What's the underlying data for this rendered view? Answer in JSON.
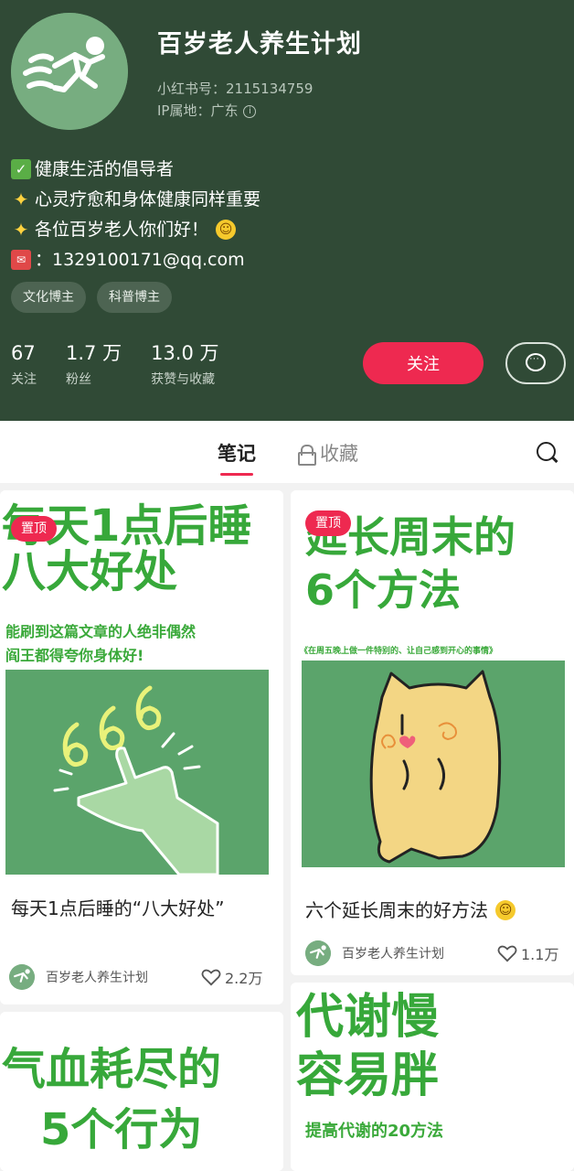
{
  "profile": {
    "name": "百岁老人养生计划",
    "account_id": "小红书号：2115134759",
    "ip_location": "IP属地：广东",
    "bio": [
      {
        "icon": "check-icon",
        "text": "健康生活的倡导者"
      },
      {
        "icon": "sparkle-icon",
        "text": "心灵疗愈和身体健康同样重要"
      },
      {
        "icon": "sparkle-icon",
        "text": "各位百岁老人你们好！"
      },
      {
        "icon": "mail-icon",
        "text": "：1329100171@qq.com"
      }
    ],
    "tags": [
      "文化博主",
      "科普博主"
    ],
    "stats": [
      {
        "value": "67",
        "label": "关注"
      },
      {
        "value": "1.7 万",
        "label": "粉丝"
      },
      {
        "value": "13.0 万",
        "label": "获赞与收藏"
      }
    ],
    "follow_label": "关注"
  },
  "tabs": {
    "notes": "笔记",
    "collections": "收藏"
  },
  "notes": [
    {
      "pin": "置顶",
      "cover_title_lines": [
        "每天1点后睡",
        "八大好处"
      ],
      "cover_sub_lines": [
        "能刷到这篇文章的人绝非偶然",
        "阎王都得夸你身体好!"
      ],
      "cover_art": "666",
      "title": "每天1点后睡的“八大好处”",
      "author": "百岁老人养生计划",
      "likes": "2.2万"
    },
    {
      "pin": "置顶",
      "cover_title_lines": [
        "延长周末的",
        "6个方法"
      ],
      "cover_sub_lines": [
        "《在周五晚上做一件特别的、让自己感到开心的事情》"
      ],
      "title": "六个延长周末的好方法",
      "author": "百岁老人养生计划",
      "likes": "1.1万"
    },
    {
      "cover_title_lines": [
        "气血耗尽的",
        "5个行为"
      ]
    },
    {
      "cover_title_lines": [
        "代谢慢",
        "容易胖"
      ],
      "cover_sub_lines": [
        "提高代谢的20方法"
      ]
    }
  ],
  "colors": {
    "header_bg": "#304a36",
    "accent": "#ee2950",
    "cover_green": "#37a83a",
    "art_green": "#5ba46b"
  }
}
